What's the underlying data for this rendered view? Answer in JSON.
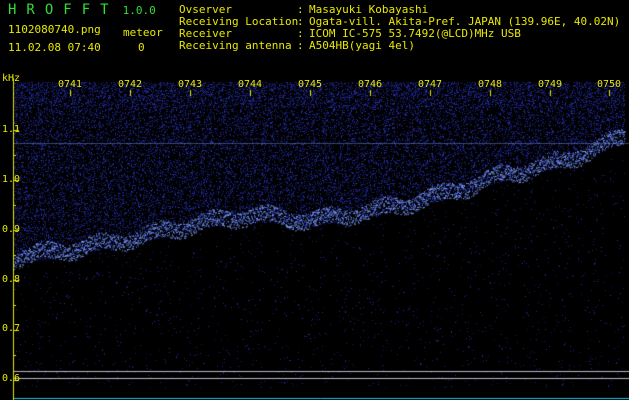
{
  "header": {
    "logo": "HROFFT",
    "version": "1.0.0",
    "filename": "1102080740.png",
    "datetime": "11.02.08 07:40",
    "mode_label": "meteor",
    "meteor_count": "0",
    "info": [
      {
        "key": "Ovserver",
        "value": "Masayuki Kobayashi"
      },
      {
        "key": "Receiving Location",
        "value": "Ogata-vill. Akita-Pref. JAPAN (139.96E, 40.02N)"
      },
      {
        "key": "Receiver",
        "value": "ICOM IC-575 53.7492(@LCD)MHz USB"
      },
      {
        "key": "Receiving antenna",
        "value": "A504HB(yagi 4el)"
      }
    ]
  },
  "colors": {
    "text": "#e8e800",
    "logo": "#33dd33",
    "background": "#000000",
    "noise": "#2a35c8",
    "signal": "#7a9cff"
  },
  "chart_data": {
    "type": "heatmap",
    "yunit": "kHz",
    "y_ticks": [
      "1.1",
      "1.0",
      "0.9",
      "0.8",
      "0.7",
      "0.6"
    ],
    "x_ticks": [
      "0741",
      "0742",
      "0743",
      "0744",
      "0745",
      "0746",
      "0747",
      "0748",
      "0749",
      "0750"
    ],
    "ylim": [
      0.58,
      1.19
    ],
    "signal_trace": [
      {
        "time": 0,
        "freq": 0.84
      },
      {
        "time": 1,
        "freq": 0.86
      },
      {
        "time": 2,
        "freq": 0.88
      },
      {
        "time": 3,
        "freq": 0.91
      },
      {
        "time": 4,
        "freq": 0.93
      },
      {
        "time": 5,
        "freq": 0.92
      },
      {
        "time": 6,
        "freq": 0.94
      },
      {
        "time": 7,
        "freq": 0.97
      },
      {
        "time": 8,
        "freq": 1.01
      },
      {
        "time": 9,
        "freq": 1.04
      },
      {
        "time": 10,
        "freq": 1.09
      }
    ],
    "horizontal_lines_khz": [
      1.074,
      0.618,
      0.604
    ]
  }
}
